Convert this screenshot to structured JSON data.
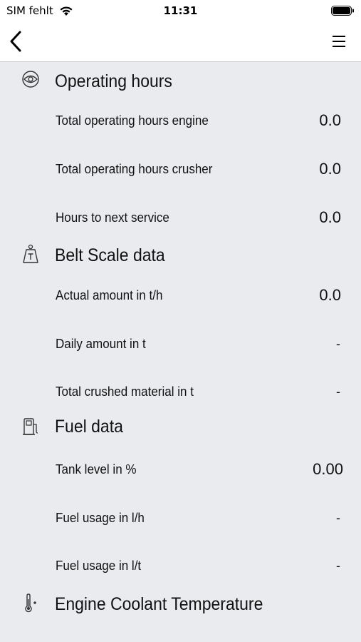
{
  "status_bar": {
    "carrier": "SIM fehlt",
    "time": "11:31",
    "wifi_icon": "wifi-icon",
    "battery_icon": "battery-full-icon"
  },
  "nav": {
    "back_icon": "chevron-left-icon",
    "menu_icon": "hamburger-menu-icon"
  },
  "sections": [
    {
      "title": "Operating hours",
      "icon": "engine-hours-icon",
      "rows": [
        {
          "label": "Total operating hours engine",
          "value": "0.0"
        },
        {
          "label": "Total operating hours crusher",
          "value": "0.0"
        },
        {
          "label": "Hours to next service",
          "value": "0.0"
        }
      ]
    },
    {
      "title": "Belt Scale data",
      "icon": "weight-scale-icon",
      "rows": [
        {
          "label": "Actual amount in t/h",
          "value": "0.0"
        },
        {
          "label": "Daily amount in t",
          "value": "-"
        },
        {
          "label": "Total crushed material in t",
          "value": "-"
        }
      ]
    },
    {
      "title": "Fuel data",
      "icon": "fuel-pump-icon",
      "rows": [
        {
          "label": "Tank level in %",
          "value": "0.00"
        },
        {
          "label": "Fuel usage in l/h",
          "value": "-"
        },
        {
          "label": "Fuel usage in l/t",
          "value": "-"
        }
      ]
    },
    {
      "title": "Engine Coolant Temperature",
      "icon": "thermometer-icon",
      "rows": []
    }
  ]
}
